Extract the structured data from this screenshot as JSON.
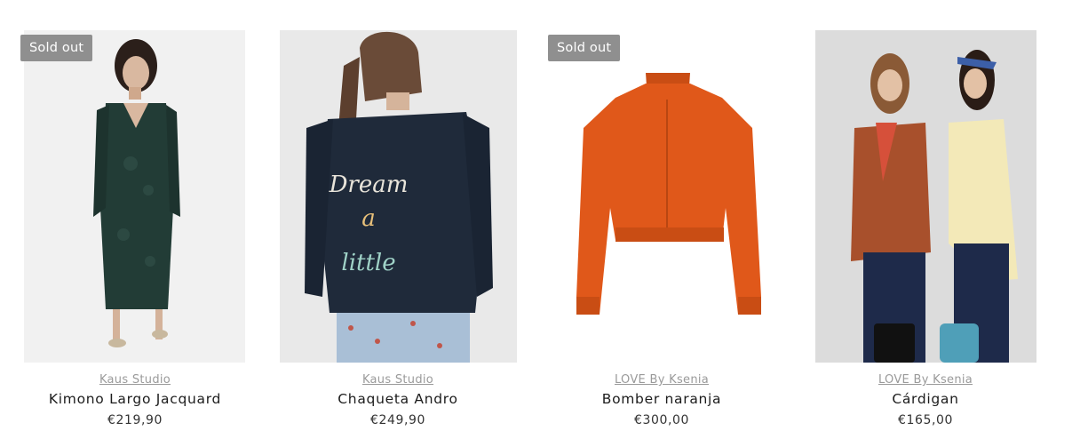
{
  "products": [
    {
      "badge": "Sold out",
      "vendor": "Kaus Studio",
      "title": "Kimono Largo Jacquard",
      "price": "€219,90"
    },
    {
      "badge": "",
      "vendor": "Kaus Studio",
      "title": "Chaqueta Andro",
      "price": "€249,90",
      "jacket_text": [
        "Dream",
        "a",
        "little"
      ]
    },
    {
      "badge": "Sold out",
      "vendor": "LOVE By Ksenia",
      "title": "Bomber naranja",
      "price": "€300,00"
    },
    {
      "badge": "",
      "vendor": "LOVE By Ksenia",
      "title": "Cárdigan",
      "price": "€165,00"
    }
  ],
  "colors": {
    "badge_bg": "#8f8f8f",
    "vendor": "#9a9a9a",
    "orange_jacket": "#e0581a",
    "kimono": "#223c36",
    "denim": "#1f2a3a",
    "cardigan": "#a8502c"
  }
}
